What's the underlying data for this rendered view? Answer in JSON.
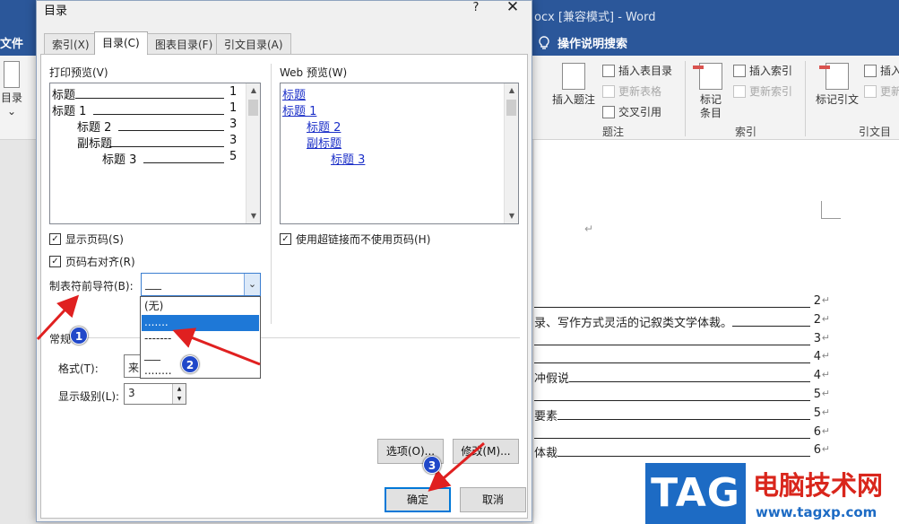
{
  "word": {
    "title": "ocx [兼容模式]  -  Word",
    "file_tab": "文件",
    "tell_me": "操作说明搜索",
    "ribbon": {
      "insert_caption": "插入题注",
      "insert_table_of_figures": "插入表目录",
      "update_table": "更新表格",
      "cross_reference": "交叉引用",
      "group_captions": "题注",
      "mark_entry": "标记\n条目",
      "insert_index": "插入索引",
      "update_index": "更新索引",
      "group_index": "索引",
      "mark_citation": "标记引文",
      "insert_table_of_authorities": "插入",
      "update_authorities": "更新",
      "group_authorities": "引文目录",
      "left_toc": "目录",
      "left_toc_arrow": "⌄"
    },
    "document_lines": [
      {
        "text": "",
        "page": "2"
      },
      {
        "text": "录、写作方式灵活的记叙类文学体裁。",
        "page": "2"
      },
      {
        "text": "",
        "page": "3"
      },
      {
        "text": "",
        "page": "4"
      },
      {
        "text": "冲假说",
        "page": "4"
      },
      {
        "text": "",
        "page": "5"
      },
      {
        "text": "要素",
        "page": "5"
      },
      {
        "text": "",
        "page": "6"
      },
      {
        "text": "体裁",
        "page": "6"
      }
    ],
    "para_mark": "↵",
    "return_mark": "↵"
  },
  "watermark": {
    "logo": "TAG",
    "site_name": "电脑技术网",
    "url": "www.tagxp.com"
  },
  "dialog": {
    "title": "目录",
    "help": "?",
    "close": "✕",
    "tabs": [
      "索引(X)",
      "目录(C)",
      "图表目录(F)",
      "引文目录(A)"
    ],
    "print_preview_label": "打印预览(V)",
    "print_preview": [
      {
        "text": "标题",
        "page": "1"
      },
      {
        "text": "标题 1",
        "page": "1"
      },
      {
        "text": "标题 2",
        "page": "3"
      },
      {
        "text": "副标题",
        "page": "3"
      },
      {
        "text": "标题 3",
        "page": "5"
      }
    ],
    "web_preview_label": "Web 预览(W)",
    "web_preview": [
      "标题",
      "标题 1",
      "标题 2",
      "副标题",
      "标题 3"
    ],
    "show_page_numbers": "显示页码(S)",
    "right_align": "页码右对齐(R)",
    "use_hyperlinks": "使用超链接而不使用页码(H)",
    "checkbox_mark": "✓",
    "tab_leader_label": "制表符前导符(B):",
    "tab_leader_value": "___",
    "tab_leader_options": [
      "(无)",
      ".......",
      "-------",
      "___",
      "........"
    ],
    "tab_leader_selected_index": 1,
    "general_label": "常规",
    "format_label": "格式(T):",
    "format_value": "来",
    "show_levels_label": "显示级别(L):",
    "show_levels_value": "3",
    "options_button": "选项(O)...",
    "modify_button": "修改(M)...",
    "ok_button": "确定",
    "cancel_button": "取消"
  },
  "annotations": [
    "1",
    "2",
    "3"
  ],
  "colors": {
    "word_blue": "#2b579a",
    "annotation_arrow": "#e02020",
    "badge_blue": "#2148c9",
    "link_blue": "#1b2fc8",
    "selection_blue": "#1e78d7"
  }
}
